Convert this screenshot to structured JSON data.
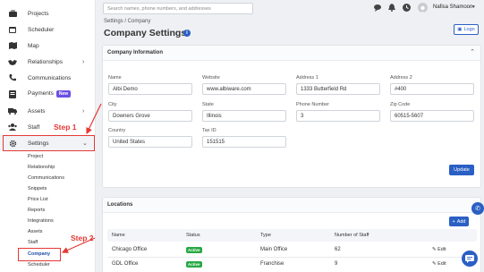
{
  "sidebar": {
    "items": [
      {
        "label": "Projects",
        "icon": "briefcase-icon"
      },
      {
        "label": "Scheduler",
        "icon": "calendar-icon"
      },
      {
        "label": "Map",
        "icon": "map-icon"
      },
      {
        "label": "Relationships",
        "icon": "handshake-icon"
      },
      {
        "label": "Communications",
        "icon": "phone-icon"
      },
      {
        "label": "Payments",
        "icon": "payments-icon",
        "badge": "New"
      },
      {
        "label": "Assets",
        "icon": "truck-icon"
      },
      {
        "label": "Staff",
        "icon": "staff-icon"
      },
      {
        "label": "Settings",
        "icon": "gear-icon"
      }
    ],
    "settings_subitems": [
      "Project",
      "Relationship",
      "Communications",
      "Snippets",
      "Price List",
      "Reports",
      "Integrations",
      "Assets",
      "Staff",
      "Company",
      "Scheduler"
    ]
  },
  "annotations": {
    "step1": "Step 1",
    "step2": "Step 2"
  },
  "topbar": {
    "search_placeholder": "Search names, phone numbers, and addresses",
    "user_name": "Nafisa Shamoon"
  },
  "breadcrumb": "Settings / Company",
  "page_title": "Company Settings",
  "logo_button": "Logo",
  "company_info": {
    "title": "Company Information",
    "fields": {
      "name": {
        "label": "Name",
        "value": "Albi Demo"
      },
      "website": {
        "label": "Website",
        "value": "www.albiware.com"
      },
      "address1": {
        "label": "Address 1",
        "value": "1333 Butterfield Rd"
      },
      "address2": {
        "label": "Address 2",
        "value": "#400"
      },
      "city": {
        "label": "City",
        "value": "Downers Grove"
      },
      "state": {
        "label": "State",
        "value": "Illinois"
      },
      "phone": {
        "label": "Phone Number",
        "value": "3"
      },
      "zip": {
        "label": "Zip Code",
        "value": "60515-5607"
      },
      "country": {
        "label": "Country",
        "value": "United States"
      },
      "tax_id": {
        "label": "Tax ID",
        "value": "151515"
      }
    },
    "update_button": "Update"
  },
  "locations": {
    "title": "Locations",
    "add_button": "Add",
    "columns": [
      "Name",
      "Status",
      "Type",
      "Number of Staff"
    ],
    "rows": [
      {
        "name": "Chicago Office",
        "status": "Active",
        "type": "Main Office",
        "staff": "62",
        "action": "Edit"
      },
      {
        "name": "GDL Office",
        "status": "Active",
        "type": "Franchise",
        "staff": "9",
        "action": "Edit"
      }
    ]
  },
  "colors": {
    "accent": "#2a5fc4",
    "highlight": "#e53935",
    "active_status": "#27a844",
    "new_badge": "#6c4ee3"
  }
}
